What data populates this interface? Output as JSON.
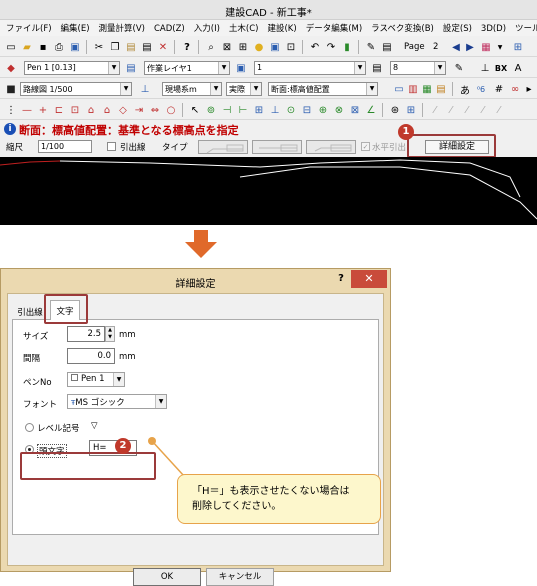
{
  "cad_window": {
    "title": "建設CAD - 新工事*",
    "menu": [
      "ファイル(F)",
      "編集(E)",
      "測量計算(V)",
      "CAD(Z)",
      "入力(I)",
      "土木(C)",
      "建設(K)",
      "データ編集(M)",
      "ラスベク変換(B)",
      "設定(S)",
      "3D(D)",
      "ツール(T)"
    ],
    "toolbar1": {
      "page_label": "Page",
      "page_number": "2"
    },
    "toolbar2": {
      "pen_combo": "Pen 1 [0.13]",
      "layer_combo": "作業レイヤ1",
      "line_combo": "1",
      "number_combo": "8"
    },
    "toolbar3": {
      "scale_combo": "路線図 1/500",
      "coord_combo": "現場系m",
      "real_combo": "実際",
      "section_combo": "断面:標高値配置"
    },
    "instruction": "断面：標高値配置：基準となる標高点を指定",
    "cmdbar": {
      "scale_label": "縮尺",
      "scale_value": "1/100",
      "leader_label": "引出線",
      "type_label": "タイプ",
      "horizontal_label": "水平引出",
      "detail_button": "詳細設定"
    },
    "badge": "1"
  },
  "dialog": {
    "title": "詳細設定",
    "help_glyph": "?",
    "close_glyph": "✕",
    "tabs": [
      "引出線",
      "文字"
    ],
    "size_label": "サイズ",
    "size_value": "2.5",
    "size_unit": "mm",
    "gap_label": "間隔",
    "gap_value": "0.0",
    "gap_unit": "mm",
    "pen_label": "ペンNo",
    "pen_value": "Pen 1",
    "font_label": "フォント",
    "font_value": "MS ゴシック",
    "level_label": "レベル記号",
    "level_symbol": "▽",
    "prefix_label": "頭文字",
    "prefix_value": "H=",
    "badge": "2",
    "callout": [
      "「H＝」も表示させたくない場合は",
      "削除してください。"
    ],
    "ok_label": "OK",
    "cancel_label": "キャンセル"
  },
  "colors": {
    "highlight": "#9b3a3a",
    "badge": "#c0392b",
    "instruction_text": "#c00000",
    "arrow": "#e0692a",
    "callout_border": "#e7a34a"
  }
}
